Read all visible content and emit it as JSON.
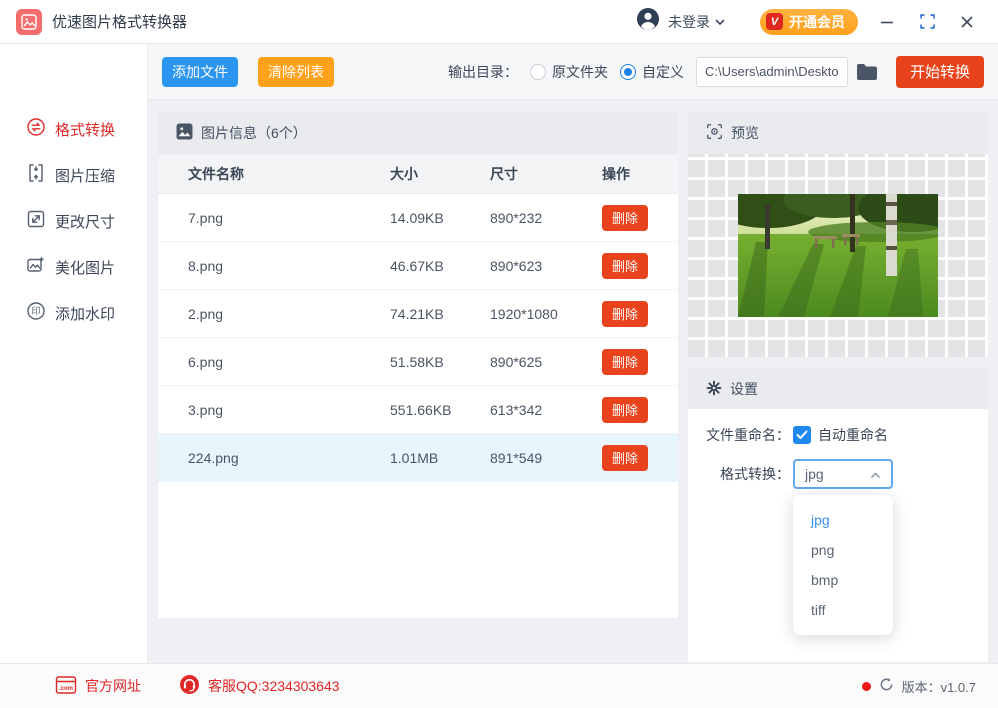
{
  "titlebar": {
    "app_title": "优速图片格式转换器",
    "login_label": "未登录",
    "vip_button": "开通会员",
    "vip_badge": "V"
  },
  "toolbar": {
    "add_files": "添加文件",
    "clear_list": "清除列表",
    "output_dir_label": "输出目录：",
    "radio_original": "原文件夹",
    "radio_custom": "自定义",
    "path_value": "C:\\Users\\admin\\Deskto",
    "start_convert": "开始转换"
  },
  "sidebar": {
    "items": [
      {
        "label": "格式转换",
        "icon": "transfer-icon",
        "active": true
      },
      {
        "label": "图片压缩",
        "icon": "compress-icon",
        "active": false
      },
      {
        "label": "更改尺寸",
        "icon": "resize-icon",
        "active": false
      },
      {
        "label": "美化图片",
        "icon": "beautify-icon",
        "active": false
      },
      {
        "label": "添加水印",
        "icon": "watermark-icon",
        "active": false
      }
    ]
  },
  "file_panel": {
    "header": "图片信息（6个）",
    "columns": [
      "文件名称",
      "大小",
      "尺寸",
      "操作"
    ],
    "delete_label": "删除",
    "selected_index": 5,
    "rows": [
      {
        "name": "7.png",
        "size": "14.09KB",
        "dims": "890*232"
      },
      {
        "name": "8.png",
        "size": "46.67KB",
        "dims": "890*623"
      },
      {
        "name": "2.png",
        "size": "74.21KB",
        "dims": "1920*1080"
      },
      {
        "name": "6.png",
        "size": "51.58KB",
        "dims": "890*625"
      },
      {
        "name": "3.png",
        "size": "551.66KB",
        "dims": "613*342"
      },
      {
        "name": "224.png",
        "size": "1.01MB",
        "dims": "891*549"
      }
    ]
  },
  "preview_panel": {
    "header": "预览"
  },
  "settings_panel": {
    "header": "设置",
    "rename_label": "文件重命名：",
    "rename_checkbox": "自动重命名",
    "rename_checked": true,
    "format_label": "格式转换：",
    "format_value": "jpg",
    "format_options": [
      "jpg",
      "png",
      "bmp",
      "tiff"
    ],
    "format_selected_option": 0
  },
  "statusbar": {
    "website": "官方网址",
    "qq": "客服QQ:3234303643",
    "version": "版本：v1.0.7"
  },
  "colors": {
    "accent_blue": "#2b95f0",
    "accent_orange": "#ffa21a",
    "accent_red": "#e8431c",
    "active_nav_red": "#e02b2b",
    "link_red": "#e02626",
    "selected_row_bg": "#e9f5fd",
    "header_bar_bg": "#e9ebee"
  }
}
